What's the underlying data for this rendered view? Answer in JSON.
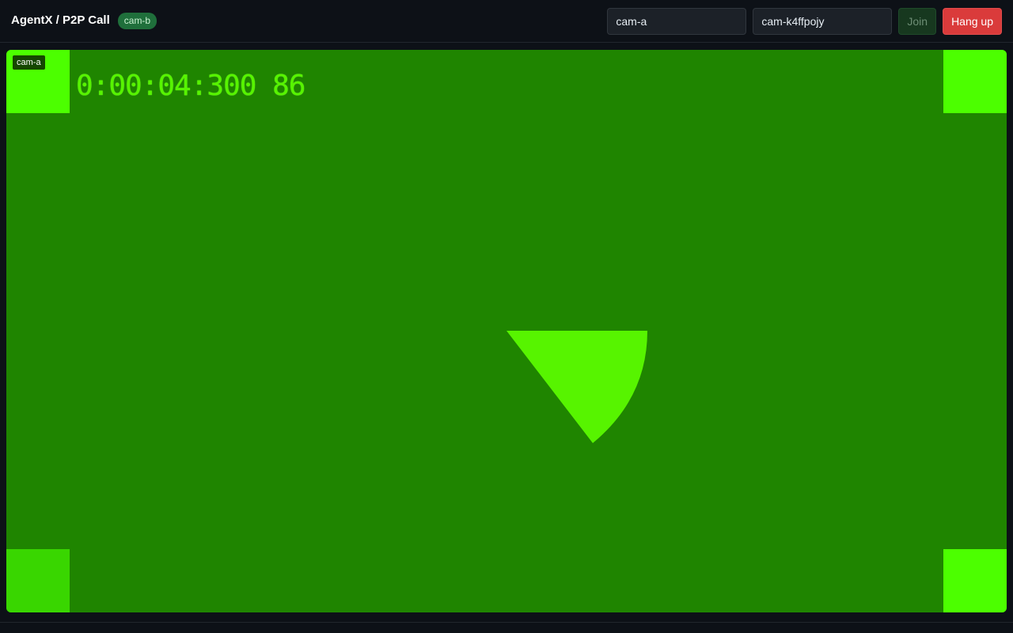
{
  "header": {
    "title": "AgentX / P2P Call",
    "self_id": "cam-b"
  },
  "controls": {
    "peer_id_value": "cam-a",
    "room_value": "cam-k4ffpojy",
    "join_label": "Join",
    "hangup_label": "Hang up"
  },
  "video": {
    "label": "cam-a",
    "timecode": "0:00:04:300 86",
    "colors": {
      "background": "#1f8500",
      "marker": "#4cff00",
      "shape": "#57f400"
    }
  }
}
